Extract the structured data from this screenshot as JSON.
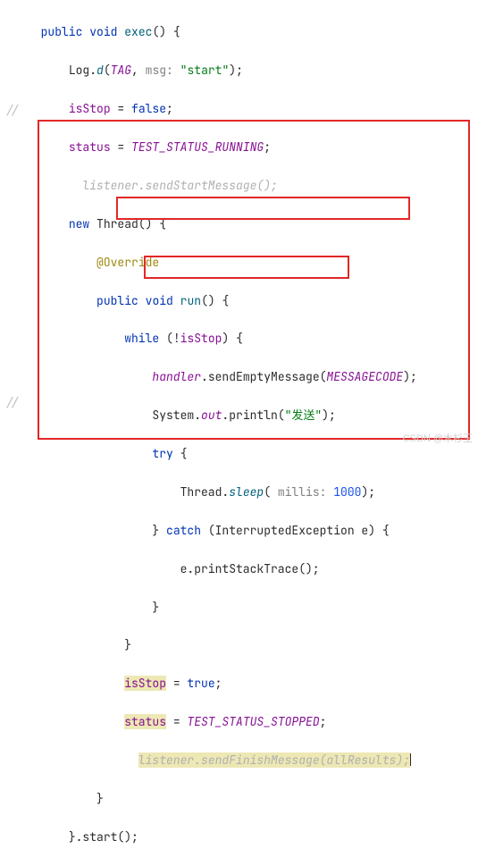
{
  "gutter": {
    "c1": "//",
    "c2": "//"
  },
  "l1": {
    "a": "public",
    "b": "void",
    "c": "exec",
    "d": "() {"
  },
  "l2": {
    "a": "Log.",
    "b": "d",
    "c": "(",
    "d": "TAG",
    "e": ", ",
    "p": "msg: ",
    "s": "\"start\"",
    "f": ");"
  },
  "l3": {
    "a": "isStop",
    "b": " = ",
    "c": "false",
    "d": ";"
  },
  "l4": {
    "a": "status",
    "b": " = ",
    "c": "TEST_STATUS_RUNNING",
    "d": ";"
  },
  "l5": {
    "a": "listener.sendStartMessage();"
  },
  "l6": {
    "a": "new",
    "b": " Thread() {"
  },
  "l7": {
    "a": "@Override"
  },
  "l8": {
    "a": "public",
    "b": "void",
    "c": "run",
    "d": "() {"
  },
  "l9": {
    "a": "while",
    "b": " (!",
    "c": "isStop",
    "d": ") {"
  },
  "l10": {
    "a": "handler",
    "b": ".sendEmptyMessage(",
    "c": "MESSAGECODE",
    "d": ");"
  },
  "l11": {
    "a": "System.",
    "b": "out",
    "c": ".println(",
    "s": "\"发送\"",
    "d": ");"
  },
  "l12": {
    "a": "try",
    "b": " {"
  },
  "l13": {
    "a": "Thread.",
    "b": "sleep",
    "c": "( ",
    "p": "millis: ",
    "n": "1000",
    "d": ");"
  },
  "l14": {
    "a": "} ",
    "b": "catch",
    "c": " (InterruptedException e) {"
  },
  "l15": {
    "a": "e.printStackTrace();"
  },
  "l16": {
    "a": "}"
  },
  "l17": {
    "a": "}"
  },
  "l18": {
    "a": "isStop",
    "b": " = ",
    "c": "true",
    "d": ";"
  },
  "l19": {
    "a": "status",
    "b": " = ",
    "c": "TEST_STATUS_STOPPED",
    "d": ";"
  },
  "l20": {
    "a": "listener.sendFinishMessage(allResults);"
  },
  "l21": {
    "a": "}"
  },
  "l22": {
    "a": "}.start();"
  },
  "watermark": "CSDN @木杉王"
}
